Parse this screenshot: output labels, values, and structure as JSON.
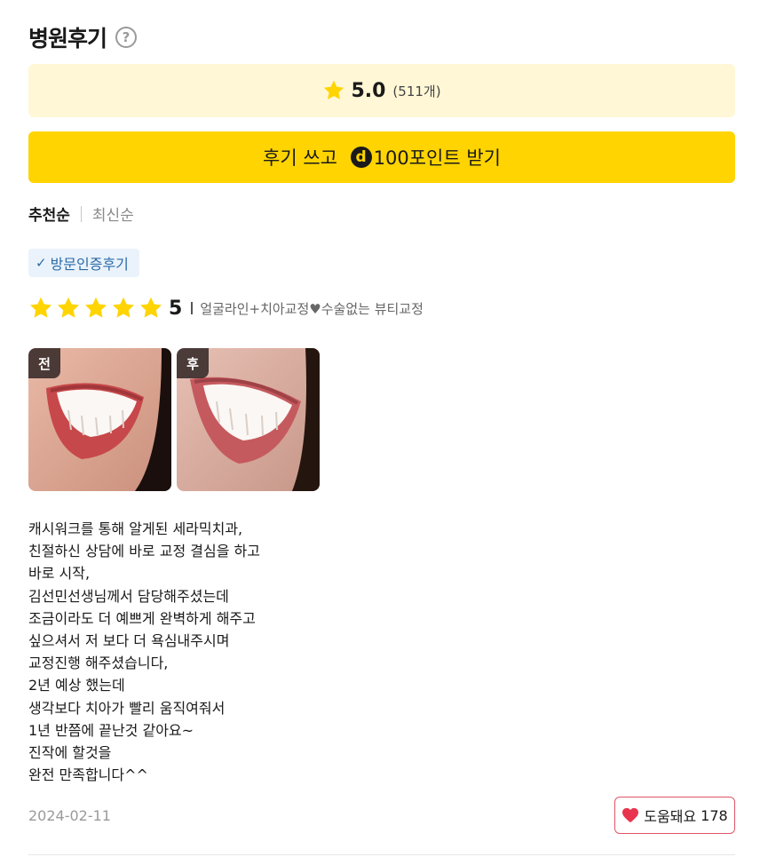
{
  "section": {
    "title": "병원후기",
    "help_icon": "question-circle-icon"
  },
  "summary": {
    "rating": "5.0",
    "count": "(511개)",
    "star_color": "#ffd400"
  },
  "cta": {
    "prefix": "후기 쓰고 ",
    "coin_symbol": "d",
    "suffix": "100포인트 받기",
    "bg": "#ffd400"
  },
  "sort": {
    "options": [
      "추천순",
      "최신순"
    ],
    "active": "추천순"
  },
  "review": {
    "badge": "방문인증후기",
    "stars": 5,
    "score": "5",
    "treatment": "얼굴라인+치아교정♥수술없는 뷰티교정",
    "photos": [
      {
        "tag": "전"
      },
      {
        "tag": "후"
      }
    ],
    "body_lines": [
      "캐시워크를 통해 알게된 세라믹치과,",
      "친절하신 상담에 바로 교정 결심을 하고",
      "바로 시작,",
      "김선민선생님께서 담당해주셨는데",
      "조금이라도 더 예쁘게 완벽하게 해주고",
      "싶으셔서 저 보다 더 욕심내주시며",
      "교정진행 해주셨습니다,",
      "2년 예상 했는데",
      "생각보다 치아가 빨리 움직여줘서",
      "1년 반쯤에 끝난것 같아요~",
      "진작에 할것을",
      "완전 만족합니다^^"
    ],
    "date": "2024-02-11",
    "helpful_label": "도움돼요",
    "helpful_count": "178",
    "heart_color": "#e8344e"
  }
}
